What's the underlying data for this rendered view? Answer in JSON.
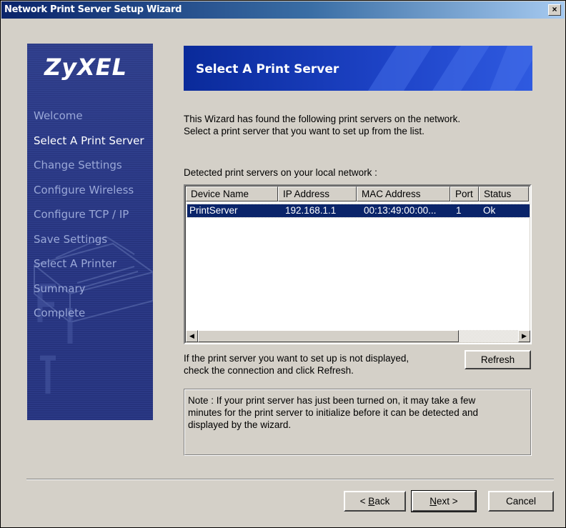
{
  "window": {
    "title": "Network Print Server Setup Wizard",
    "close_glyph": "×"
  },
  "sidebar": {
    "logo": "ZyXEL",
    "steps": [
      {
        "label": "Welcome",
        "active": false
      },
      {
        "label": "Select A Print Server",
        "active": true
      },
      {
        "label": "Change Settings",
        "active": false
      },
      {
        "label": "Configure Wireless",
        "active": false
      },
      {
        "label": "Configure  TCP / IP",
        "active": false
      },
      {
        "label": "Save Settings",
        "active": false
      },
      {
        "label": "Select A Printer",
        "active": false
      },
      {
        "label": "Summary",
        "active": false
      },
      {
        "label": "Complete",
        "active": false
      }
    ]
  },
  "banner": {
    "title": "Select A Print Server"
  },
  "description": {
    "line1": "This Wizard has found the following print servers on the network.",
    "line2": "Select a print server that you want to set up from the list."
  },
  "detected_label": "Detected print servers on your local network :",
  "list": {
    "columns": [
      "Device Name",
      "IP Address",
      "MAC Address",
      "Port",
      "Status"
    ],
    "rows": [
      {
        "device_name": "PrintServer",
        "ip": "192.168.1.1",
        "mac": "00:13:49:00:00...",
        "port": "1",
        "status": "Ok",
        "selected": true
      }
    ],
    "scroll_left_glyph": "◀",
    "scroll_right_glyph": "▶"
  },
  "hint": {
    "line1": "If the print server you want to set up is not displayed,",
    "line2": "check the connection and click Refresh."
  },
  "refresh_label": "Refresh",
  "note": {
    "line1": "Note : If your print server has just been turned on, it may take a few",
    "line2": "minutes for the print server to initialize before it can be detected and",
    "line3": "displayed by the wizard."
  },
  "buttons": {
    "back_prefix": "< ",
    "back_mnemonic": "B",
    "back_rest": "ack",
    "next_mnemonic": "N",
    "next_rest": "ext >",
    "cancel": "Cancel"
  },
  "colors": {
    "dialog_bg": "#d4d0c8",
    "titlebar": "#0a246a",
    "banner": "#1e44c8",
    "sidebar": "#26337d",
    "selection": "#0a246a"
  }
}
